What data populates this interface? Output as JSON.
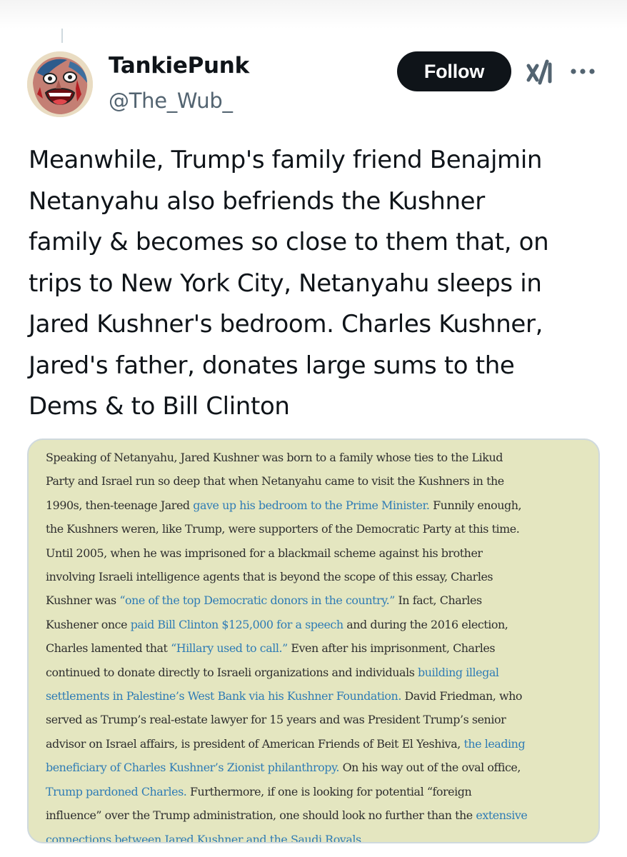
{
  "author": {
    "display_name": "TankiePunk",
    "handle": "@The_Wub_"
  },
  "actions": {
    "follow_label": "Follow"
  },
  "icons": {
    "avatar": "avatar",
    "grok": "grok-icon",
    "more": "more-icon"
  },
  "colors": {
    "follow_bg": "#0f1419",
    "link": "#2f7cb5",
    "card_bg": "#e4e6c0"
  },
  "tweet": {
    "lines": [
      "Meanwhile, Trump's family friend Benajmin",
      "Netanyahu also befriends the Kushner",
      "family & becomes so close to them that, on",
      "trips to New York City, Netanyahu sleeps in",
      "Jared Kushner's bedroom. Charles Kushner,",
      "Jared's father, donates large sums to the",
      "Dems & to Bill Clinton"
    ]
  },
  "excerpt": {
    "l1": "Speaking of Netanyahu, Jared Kushner was born to a family whose ties to the Likud",
    "l2": "Party and Israel run so deep that when Netanyahu came to visit the Kushners in the",
    "l3a": "1990s, then-teenage Jared ",
    "l3link": "gave up his bedroom to the Prime Minister.",
    "l3b": " Funnily enough,",
    "l4": "the Kushners weren, like Trump, were supporters of the Democratic Party at this time.",
    "l5": "Until 2005, when he was imprisoned for a blackmail scheme against his brother",
    "l6": "involving Israeli intelligence agents that is beyond the scope of this essay, Charles",
    "l7a": "Kushner was ",
    "l7link": "“one of the top Democratic donors in the country.”",
    "l7b": " In fact, Charles",
    "l8a": "Kushener once ",
    "l8link": "paid Bill Clinton $125,000 for a speech",
    "l8b": " and during the 2016 election,",
    "l9a": "Charles lamented that ",
    "l9link": "“Hillary used to call.”",
    "l9b": " Even after his imprisonment, Charles",
    "l10a": "continued to donate directly to Israeli organizations and individuals ",
    "l10link": "building illegal",
    "l11link": "settlements in Palestine’s West Bank via his Kushner Foundation.",
    "l11b": " David Friedman, who",
    "l12": "served as Trump’s real-estate lawyer for 15 years and was President Trump’s senior",
    "l13a": "advisor on Israel affairs, is president of American Friends of Beit El Yeshiva, ",
    "l13link": "the leading",
    "l14link": "beneficiary of Charles Kushner’s Zionist philanthropy.",
    "l14b": " On his way out of the oval office,",
    "l15link": "Trump pardoned Charles.",
    "l15b": " Furthermore, if one is looking for potential “foreign",
    "l16a": "influence” over the Trump administration, one should look no further than the ",
    "l16link": "extensive",
    "l17link": "connections between Jared Kushner and the Saudi Royals."
  }
}
